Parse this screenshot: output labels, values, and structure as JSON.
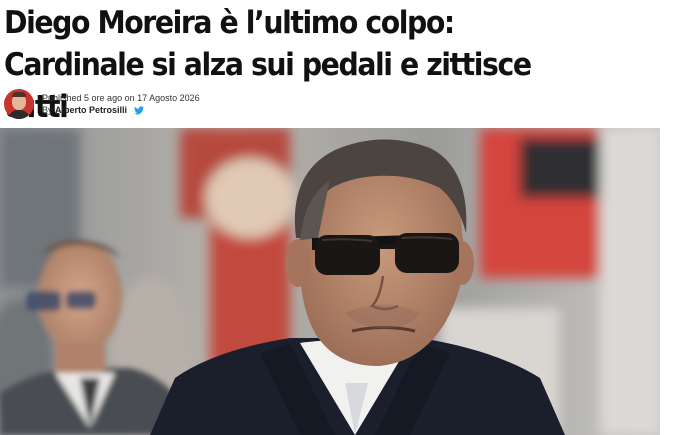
{
  "article": {
    "headline": "Diego Moreira è l’ultimo colpo: Cardinale si alza sui pedali e zittisce tutti",
    "published_prefix": "Published",
    "published_relative": "5 ore ago",
    "published_on": "on",
    "published_date": "17 Agosto 2026",
    "by_label": "By",
    "author": "Alberto Petrosilli"
  },
  "icons": {
    "author_avatar": "avatar-photo",
    "social": "twitter-bird-icon"
  },
  "colors": {
    "headline": "#111111",
    "twitter": "#1da1f2",
    "avatar_bg": "#c8342e"
  }
}
